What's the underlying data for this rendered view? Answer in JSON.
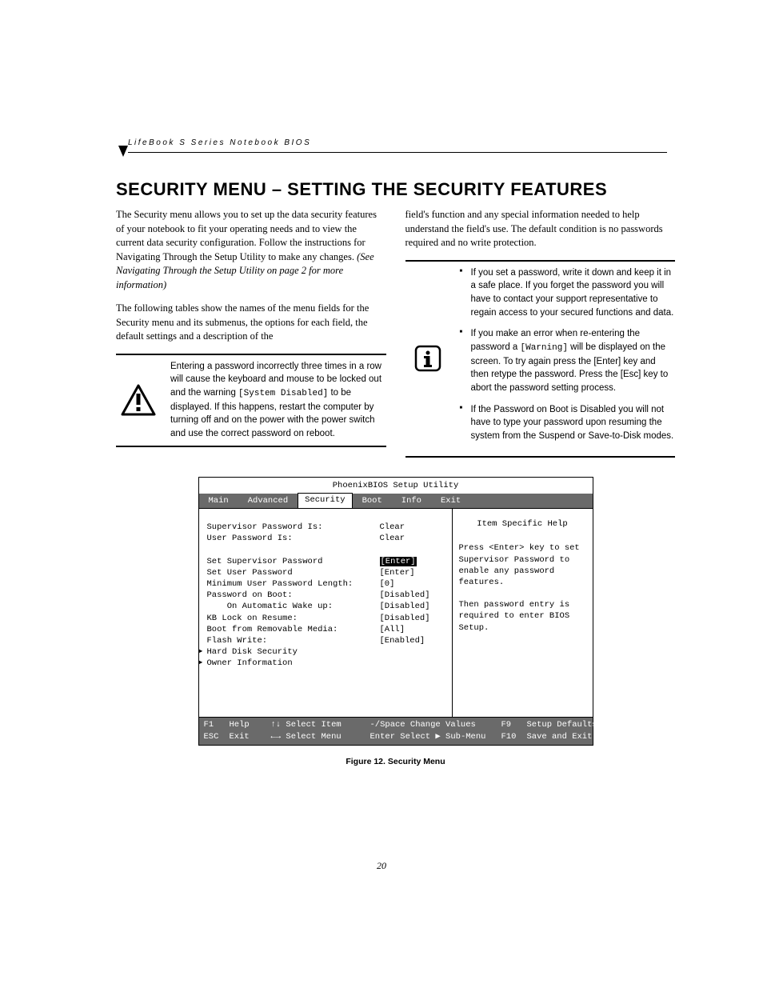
{
  "running_head": "LifeBook S Series Notebook BIOS",
  "title": "SECURITY MENU – SETTING THE SECURITY FEATURES",
  "left_col": {
    "p1a": "The Security menu allows you to set up the data security features of your notebook to fit your operating needs and to view the current data security configuration. Follow the instructions for Navigating Through the Setup Utility to make any changes. ",
    "p1b": "(See Navigating Through the Setup Utility on page 2 for more information)",
    "p2": "The following tables show the names of the menu fields for the Security menu and its submenus, the options for each field, the default settings and a description of the"
  },
  "right_col": {
    "p1": "field's function and any special information needed to help understand the field's use. The default condition is no passwords required and no write protection."
  },
  "warning_note": {
    "t1": "Entering a password incorrectly three times in a row will cause the keyboard and mouse to be locked out and the warning ",
    "t2": "[System Disabled]",
    "t3": " to be displayed. If this happens, restart the computer by turning off and on the power with the power switch and use the correct password on reboot."
  },
  "info_note": {
    "li1": "If you set a password, write it down and keep it in a safe place. If you forget the password you will have to contact your support representative to regain access to your secured functions and data.",
    "li2a": "If you make an error when re-entering the password a ",
    "li2b": "[Warning]",
    "li2c": " will be displayed on the screen. To try again press the [Enter] key and then retype the password. Press the [Esc] key to abort the password setting process.",
    "li3": "If the Password on Boot is Disabled you will not have to type your password upon resuming the system from the Suspend or Save-to-Disk modes."
  },
  "bios": {
    "title": "PhoenixBIOS Setup Utility",
    "tabs": [
      "Main",
      "Advanced",
      "Security",
      "Boot",
      "Info",
      "Exit"
    ],
    "active_tab": "Security",
    "rows": [
      {
        "label": "Supervisor Password Is:",
        "val": "Clear"
      },
      {
        "label": "User Password Is:",
        "val": "Clear"
      },
      {
        "label": "",
        "val": ""
      },
      {
        "label": "Set Supervisor Password",
        "val": "[Enter]",
        "selected": true
      },
      {
        "label": "Set User Password",
        "val": "[Enter]"
      },
      {
        "label": "Minimum User Password Length:",
        "val": "[0]"
      },
      {
        "label": "Password on Boot:",
        "val": "[Disabled]"
      },
      {
        "label": "    On Automatic Wake up:",
        "val": "[Disabled]"
      },
      {
        "label": "KB Lock on Resume:",
        "val": "[Disabled]"
      },
      {
        "label": "Boot from Removable Media:",
        "val": "[All]"
      },
      {
        "label": "Flash Write:",
        "val": "[Enabled]"
      }
    ],
    "submenus": [
      "Hard Disk Security",
      "Owner Information"
    ],
    "help": {
      "title": "Item Specific Help",
      "body": "Press <Enter> key to set Supervisor Password to enable any password features.\n\nThen password entry is required to enter BIOS Setup."
    },
    "footer": {
      "r1": {
        "k1": "F1",
        "l1": "Help",
        "nav": "↑↓ Select Item",
        "mid": "-/Space Change Values",
        "rk": "F9",
        "rl": "Setup Defaults"
      },
      "r2": {
        "k1": "ESC",
        "l1": "Exit",
        "nav": "←→ Select Menu",
        "mid": "Enter Select ▶ Sub-Menu",
        "rk": "F10",
        "rl": "Save and Exit"
      }
    }
  },
  "figure_caption": "Figure 12.   Security Menu",
  "page_number": "20"
}
